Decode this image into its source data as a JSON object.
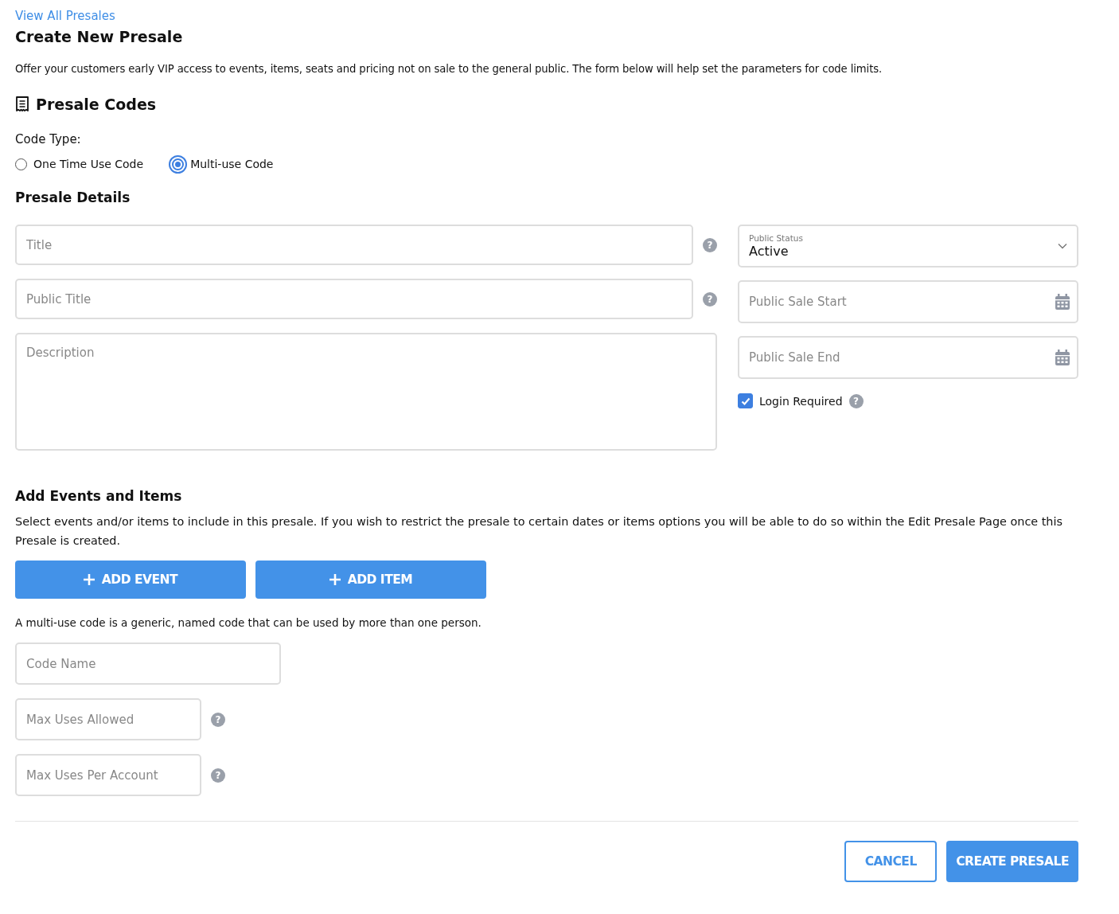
{
  "back_link": "View All Presales",
  "title": "Create New Presale",
  "intro": "Offer your customers early VIP access to events, items, seats and pricing not on sale to the general public. The form below will help set the parameters for code limits.",
  "section_title": "Presale Codes",
  "code_type": {
    "label": "Code Type:",
    "options": [
      {
        "label": "One Time Use Code",
        "selected": false
      },
      {
        "label": "Multi-use Code",
        "selected": true
      }
    ]
  },
  "details_title": "Presale Details",
  "left_fields": [
    {
      "kind": "input",
      "placeholder": "Title",
      "help": "?"
    },
    {
      "kind": "input",
      "placeholder": "Public Title",
      "help": "?"
    },
    {
      "kind": "textarea",
      "placeholder": "Description"
    }
  ],
  "status": {
    "label": "Public Status",
    "value": "Active"
  },
  "dates": [
    {
      "placeholder": "Public Sale Start"
    },
    {
      "placeholder": "Public Sale End"
    }
  ],
  "login_required": {
    "label": "Login Required",
    "checked": true,
    "help": "?"
  },
  "events": {
    "title": "Add Events and Items",
    "text": "Select events and/or items to include in this presale. If you wish to restrict the presale to certain dates or items options you will be able to do so within the Edit Presale Page once this Presale is created.",
    "buttons": [
      "ADD EVENT",
      "ADD ITEM"
    ]
  },
  "note": "A multi-use code is a generic, named code that can be used by more than one person.",
  "code_fields": [
    {
      "kind": "wide",
      "placeholder": "Code Name"
    },
    {
      "kind": "narrow",
      "placeholder": "Max Uses Allowed",
      "help": "?"
    },
    {
      "kind": "narrow",
      "placeholder": "Max Uses Per Account",
      "help": "?"
    }
  ],
  "actions": [
    {
      "label": "CANCEL",
      "kind": "secondary"
    },
    {
      "label": "CREATE PRESALE",
      "kind": "primary"
    }
  ]
}
